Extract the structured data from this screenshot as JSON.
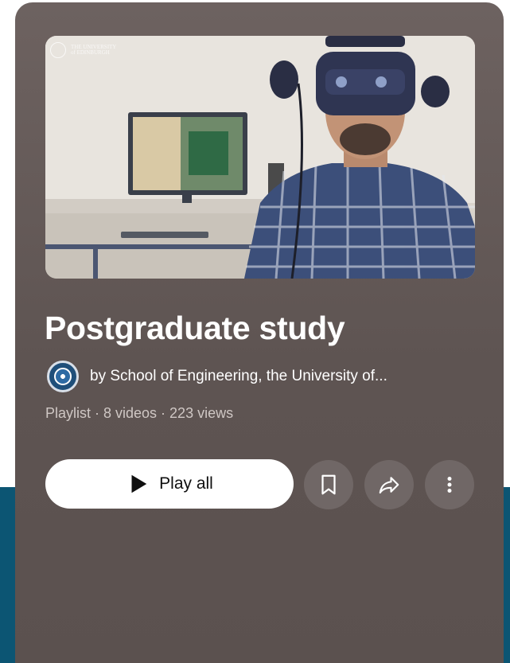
{
  "thumbnail": {
    "logo_text": "THE UNIVERSITY\nof EDINBURGH"
  },
  "playlist": {
    "title": "Postgraduate study",
    "owner": "by School of Engineering, the University of...",
    "meta": "Playlist · 8 videos · 223 views"
  },
  "actions": {
    "play_all_label": "Play all",
    "icons": [
      "play-icon",
      "bookmark-icon",
      "share-icon",
      "more-vert-icon"
    ]
  },
  "colors": {
    "card_background": "#6d6260",
    "page_band": "#0c5573",
    "play_button": "#ffffff",
    "icon_button": "rgba(255,255,255,0.12)"
  }
}
